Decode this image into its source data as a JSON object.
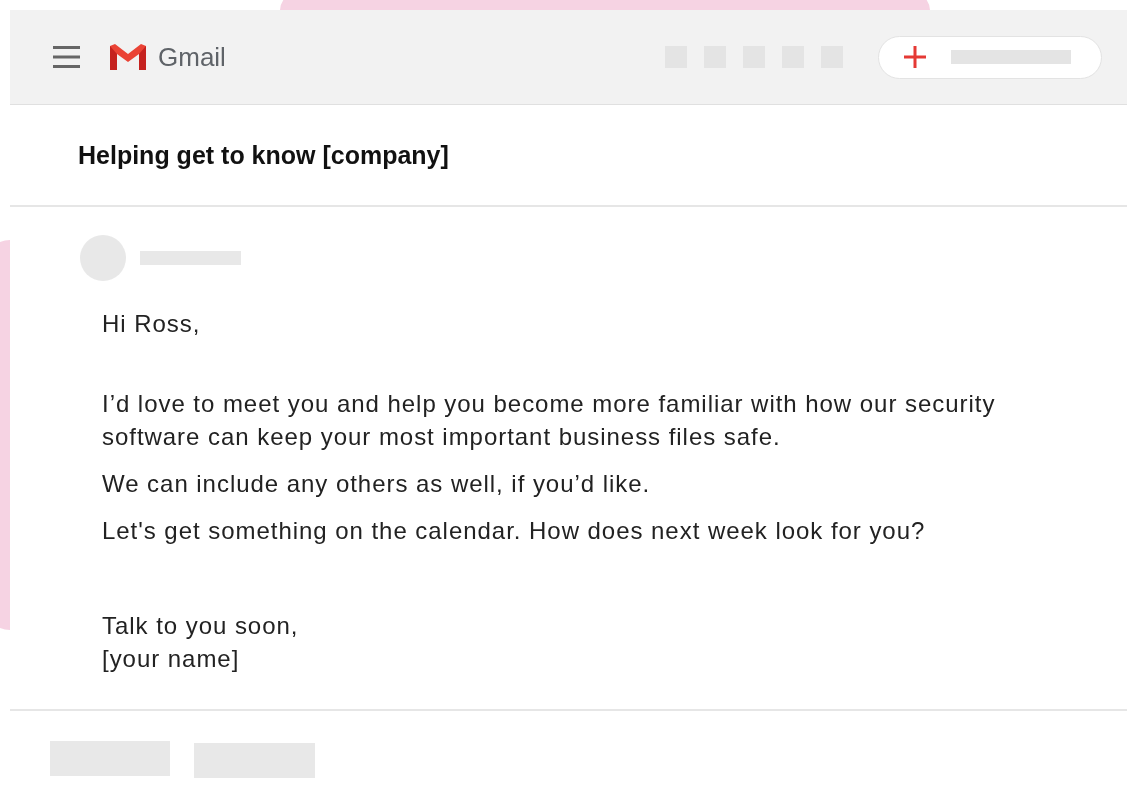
{
  "header": {
    "app_name": "Gmail"
  },
  "email": {
    "subject": "Helping get to know [company]",
    "greeting": "Hi Ross,",
    "paragraphs": [
      "I’d love to meet you and help you become more familiar with how our security software can keep your most important business files safe.",
      "We can include any others as well, if you’d like.",
      "Let's get something on the calendar. How does next week look for you?"
    ],
    "sign_off": [
      "Talk to you soon,",
      "[your name]"
    ]
  }
}
